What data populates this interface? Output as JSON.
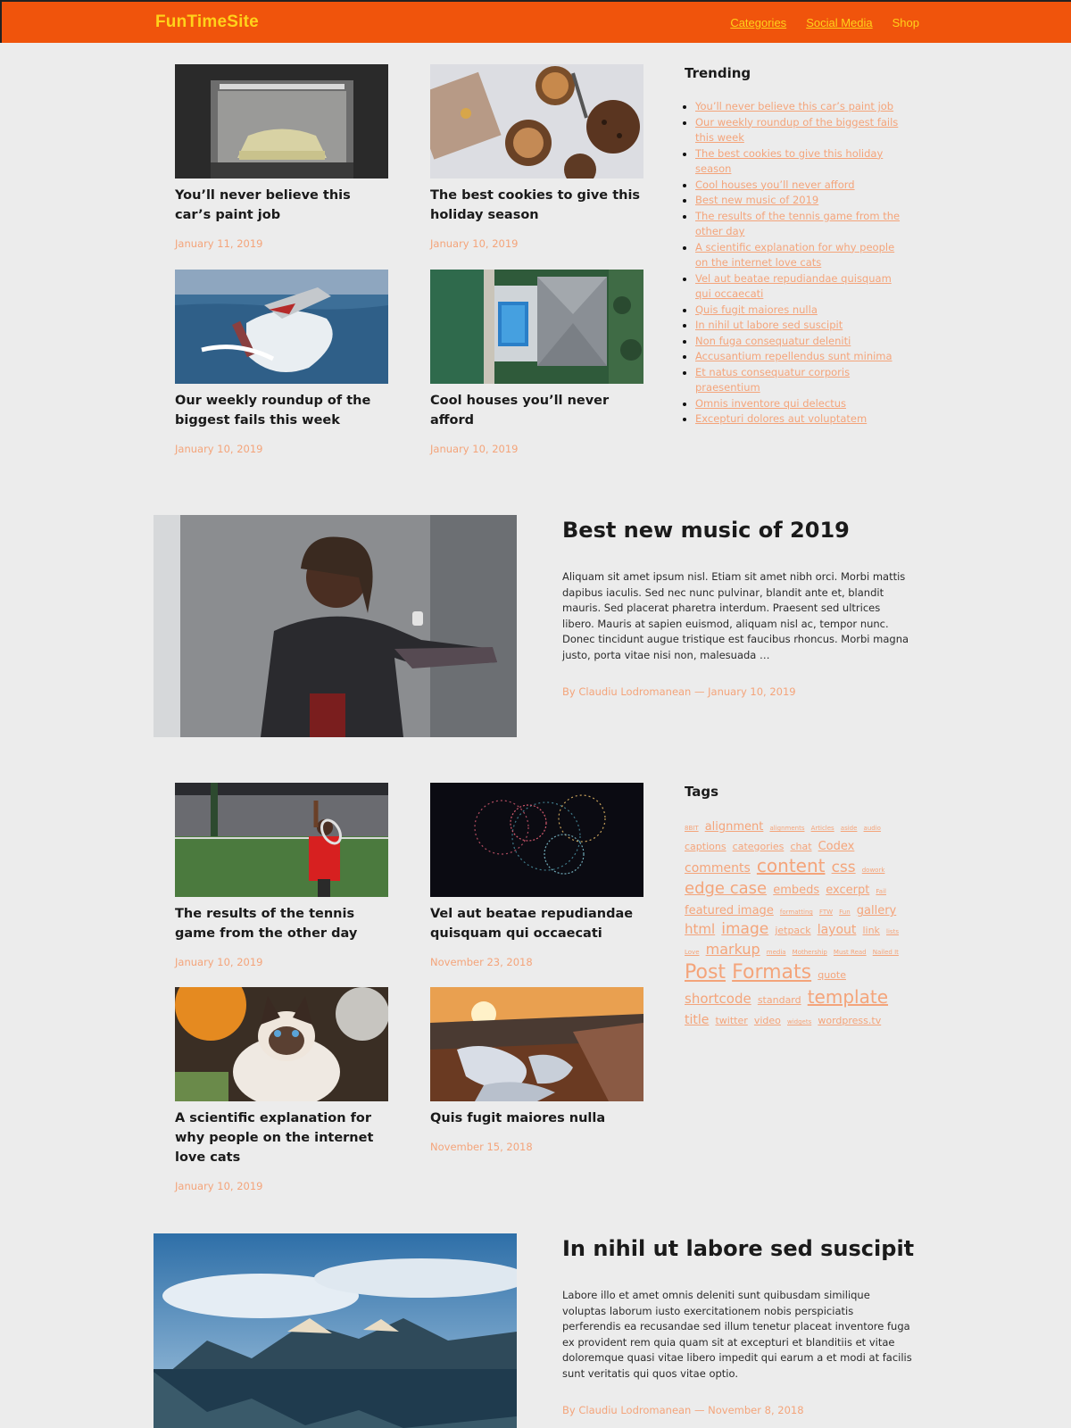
{
  "site": {
    "brand": "FunTimeSite",
    "nav": [
      {
        "label": "Categories"
      },
      {
        "label": "Social Media"
      },
      {
        "label": "Shop"
      }
    ]
  },
  "section1": {
    "cards": [
      {
        "title": "You’ll never believe this car’s paint job",
        "date": "January 11, 2019",
        "image": "car-paint-booth"
      },
      {
        "title": "The best cookies to give this holiday season",
        "date": "January 10, 2019",
        "image": "cookies-and-gift"
      },
      {
        "title": "Our weekly roundup of the biggest fails this week",
        "date": "January 10, 2019",
        "image": "jet-ski-fail"
      },
      {
        "title": "Cool houses you’ll never afford",
        "date": "January 10, 2019",
        "image": "aerial-house-pool"
      }
    ]
  },
  "trending": {
    "heading": "Trending",
    "items": [
      "You’ll never believe this car’s paint job",
      "Our weekly roundup of the biggest fails this week",
      "The best cookies to give this holiday season",
      "Cool houses you’ll never afford",
      "Best new music of 2019",
      "The results of the tennis game from the other day",
      "A scientific explanation for why people on the internet love cats",
      "Vel aut beatae repudiandae quisquam qui occaecati",
      "Quis fugit maiores nulla",
      "In nihil ut labore sed suscipit",
      "Non fuga consequatur deleniti",
      "Accusantium repellendus sunt minima",
      "Et natus consequatur corporis praesentium",
      "Omnis inventore qui delectus",
      "Excepturi dolores aut voluptatem"
    ]
  },
  "feature1": {
    "title": "Best new music of 2019",
    "excerpt": "Aliquam sit amet ipsum nisl. Etiam sit amet nibh orci. Morbi mattis dapibus iaculis. Sed nec nunc pulvinar, blandit ante et, blandit mauris. Sed placerat pharetra interdum. Praesent sed ultrices libero. Mauris at sapien euismod, aliquam nisl ac, tempor nunc. Donec tincidunt augue tristique est faucibus rhoncus. Morbi magna justo, porta vitae nisi non, malesuada …",
    "byline": "By Claudiu Lodromanean — January 10, 2019",
    "image": "musician-portrait"
  },
  "section2": {
    "cards": [
      {
        "title": "The results of the tennis game from the other day",
        "date": "January 10, 2019",
        "image": "tennis-serve"
      },
      {
        "title": "Vel aut beatae repudiandae quisquam qui occaecati",
        "date": "November 23, 2018",
        "image": "fireworks"
      },
      {
        "title": "A scientific explanation for why people on the internet love cats",
        "date": "January 10, 2019",
        "image": "siamese-cat"
      },
      {
        "title": "Quis fugit maiores nulla",
        "date": "November 15, 2018",
        "image": "sunset-road-puddles"
      }
    ]
  },
  "tags": {
    "heading": "Tags",
    "items": [
      {
        "label": "8BIT",
        "size": 7
      },
      {
        "label": "alignment",
        "size": 13
      },
      {
        "label": "alignments",
        "size": 7
      },
      {
        "label": "Articles",
        "size": 7
      },
      {
        "label": "aside",
        "size": 7
      },
      {
        "label": "audio",
        "size": 7
      },
      {
        "label": "captions",
        "size": 11
      },
      {
        "label": "categories",
        "size": 11
      },
      {
        "label": "chat",
        "size": 11
      },
      {
        "label": "Codex",
        "size": 13
      },
      {
        "label": "comments",
        "size": 14
      },
      {
        "label": "content",
        "size": 20
      },
      {
        "label": "css",
        "size": 17
      },
      {
        "label": "dowork",
        "size": 7
      },
      {
        "label": "edge case",
        "size": 18
      },
      {
        "label": "embeds",
        "size": 13
      },
      {
        "label": "excerpt",
        "size": 13
      },
      {
        "label": "Fail",
        "size": 7
      },
      {
        "label": "featured image",
        "size": 13
      },
      {
        "label": "formatting",
        "size": 7
      },
      {
        "label": "FTW",
        "size": 7
      },
      {
        "label": "Fun",
        "size": 7
      },
      {
        "label": "gallery",
        "size": 13
      },
      {
        "label": "html",
        "size": 15
      },
      {
        "label": "image",
        "size": 17
      },
      {
        "label": "jetpack",
        "size": 11
      },
      {
        "label": "layout",
        "size": 14
      },
      {
        "label": "link",
        "size": 11
      },
      {
        "label": "lists",
        "size": 7
      },
      {
        "label": "Love",
        "size": 7
      },
      {
        "label": "markup",
        "size": 16
      },
      {
        "label": "media",
        "size": 7
      },
      {
        "label": "Mothership",
        "size": 7
      },
      {
        "label": "Must Read",
        "size": 7
      },
      {
        "label": "Nailed It",
        "size": 7
      },
      {
        "label": "Post",
        "size": 22
      },
      {
        "label": "Formats",
        "size": 22
      },
      {
        "label": "quote",
        "size": 11
      },
      {
        "label": "shortcode",
        "size": 15
      },
      {
        "label": "standard",
        "size": 11
      },
      {
        "label": "template",
        "size": 20
      },
      {
        "label": "title",
        "size": 14
      },
      {
        "label": "twitter",
        "size": 11
      },
      {
        "label": "video",
        "size": 11
      },
      {
        "label": "widgets",
        "size": 7
      },
      {
        "label": "wordpress.tv",
        "size": 11
      }
    ]
  },
  "feature2": {
    "title": "In nihil ut labore sed suscipit",
    "excerpt": "Labore illo et amet omnis deleniti sunt quibusdam similique voluptas laborum iusto exercitationem nobis perspiciatis perferendis ea recusandae sed illum tenetur placeat inventore fuga ex provident rem quia quam sit at excepturi et blanditiis et vitae doloremque quasi vitae libero impedit qui earum a et modi at facilis sunt veritatis qui quos vitae optio.",
    "byline": "By Claudiu Lodromanean — November 8, 2018",
    "image": "mountain-lake"
  }
}
